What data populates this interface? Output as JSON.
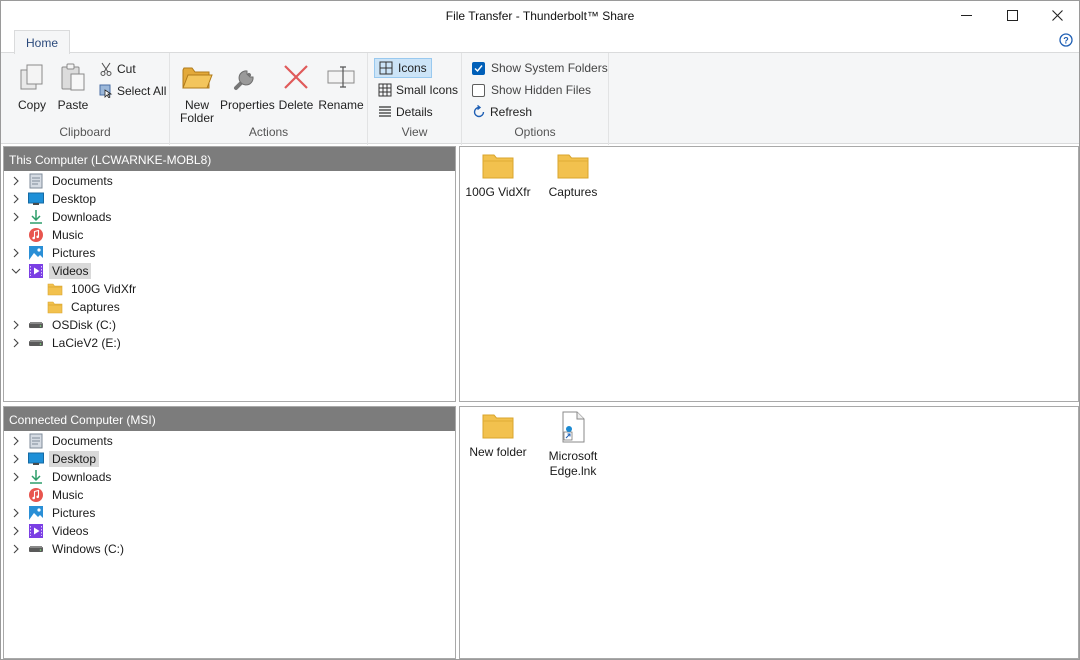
{
  "window": {
    "title": "File Transfer - Thunderbolt™ Share"
  },
  "tabs": {
    "home": "Home"
  },
  "ribbon": {
    "clipboard": {
      "label": "Clipboard",
      "copy": "Copy",
      "paste": "Paste",
      "cut": "Cut",
      "select_all": "Select All"
    },
    "actions": {
      "label": "Actions",
      "new_folder_line1": "New",
      "new_folder_line2": "Folder",
      "properties": "Properties",
      "delete": "Delete",
      "rename": "Rename"
    },
    "view": {
      "label": "View",
      "icons": "Icons",
      "small_icons": "Small Icons",
      "details": "Details",
      "selected": "Icons"
    },
    "options": {
      "label": "Options",
      "show_system_folders": "Show System Folders",
      "show_system_folders_checked": true,
      "show_hidden_files": "Show Hidden Files",
      "show_hidden_files_checked": false,
      "refresh": "Refresh"
    }
  },
  "local": {
    "header": "This Computer (LCWARNKE-MOBL8)",
    "tree": [
      {
        "label": "Documents",
        "icon": "documents-icon",
        "expander": "collapsed"
      },
      {
        "label": "Desktop",
        "icon": "desktop-icon",
        "expander": "collapsed"
      },
      {
        "label": "Downloads",
        "icon": "downloads-icon",
        "expander": "collapsed"
      },
      {
        "label": "Music",
        "icon": "music-icon",
        "expander": "none"
      },
      {
        "label": "Pictures",
        "icon": "pictures-icon",
        "expander": "collapsed"
      },
      {
        "label": "Videos",
        "icon": "videos-icon",
        "expander": "expanded",
        "selected": true
      },
      {
        "label": "100G VidXfr",
        "icon": "folder-icon",
        "expander": "none",
        "child": true
      },
      {
        "label": "Captures",
        "icon": "folder-icon",
        "expander": "none",
        "child": true
      },
      {
        "label": "OSDisk (C:)",
        "icon": "drive-icon",
        "expander": "collapsed"
      },
      {
        "label": "LaCieV2 (E:)",
        "icon": "drive-icon",
        "expander": "collapsed"
      }
    ],
    "items": [
      {
        "label": "100G VidXfr",
        "icon": "folder-icon"
      },
      {
        "label": "Captures",
        "icon": "folder-icon"
      }
    ]
  },
  "remote": {
    "header": "Connected Computer (MSI)",
    "tree": [
      {
        "label": "Documents",
        "icon": "documents-icon",
        "expander": "collapsed"
      },
      {
        "label": "Desktop",
        "icon": "desktop-icon",
        "expander": "collapsed",
        "selected": true
      },
      {
        "label": "Downloads",
        "icon": "downloads-icon",
        "expander": "collapsed"
      },
      {
        "label": "Music",
        "icon": "music-icon",
        "expander": "none"
      },
      {
        "label": "Pictures",
        "icon": "pictures-icon",
        "expander": "collapsed"
      },
      {
        "label": "Videos",
        "icon": "videos-icon",
        "expander": "collapsed"
      },
      {
        "label": "Windows (C:)",
        "icon": "drive-icon",
        "expander": "collapsed"
      }
    ],
    "items": [
      {
        "label": "New folder",
        "icon": "folder-icon"
      },
      {
        "label_line1": "Microsoft",
        "label_line2": "Edge.lnk",
        "icon": "shortcut-file-icon"
      }
    ]
  },
  "colors": {
    "pane_header": "#7c7c7c",
    "selection": "#d9d9d9",
    "ribbon_bg": "#f5f6f7",
    "view_active": "#cce4f7",
    "checkbox_accent": "#005fb8"
  }
}
